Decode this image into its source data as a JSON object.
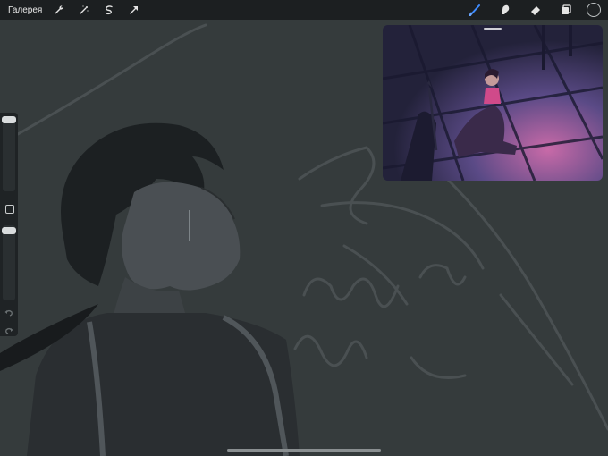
{
  "topbar": {
    "gallery_label": "Галерея",
    "left_tools": [
      "wrench-icon",
      "magic-wand-icon",
      "selection-icon",
      "transform-arrow-icon"
    ],
    "right_tools": [
      "brush-icon",
      "smudge-icon",
      "eraser-icon",
      "layers-icon"
    ],
    "active_tool": "brush-icon",
    "accent_color": "#3f8cff",
    "current_color": "#1f2224"
  },
  "sidebar": {
    "brush_size_level": 0.92,
    "opacity_level": 0.95
  },
  "reference": {
    "palette": [
      "#2b2a44",
      "#5a3f7a",
      "#c85aa0",
      "#8a5fb5",
      "#24233a"
    ]
  }
}
